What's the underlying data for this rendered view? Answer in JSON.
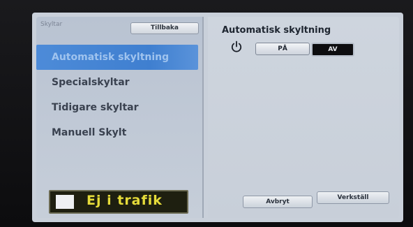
{
  "header": {
    "breadcrumb": "Skyltar",
    "back_label": "Tillbaka"
  },
  "menu": {
    "items": [
      {
        "label": "Automatisk skyltning",
        "active": true
      },
      {
        "label": "Specialskyltar",
        "active": false
      },
      {
        "label": "Tidigare skyltar",
        "active": false
      },
      {
        "label": "Manuell Skylt",
        "active": false
      }
    ]
  },
  "status": {
    "text": "Ej i trafik"
  },
  "detail": {
    "title": "Automatisk skyltning",
    "power_icon": "power-icon",
    "on_label": "PÅ",
    "off_label": "AV",
    "selected": "AV"
  },
  "actions": {
    "cancel_label": "Avbryt",
    "apply_label": "Verkställ"
  },
  "colors": {
    "accent": "#3f7fd0",
    "status_text": "#e6dc3a"
  }
}
